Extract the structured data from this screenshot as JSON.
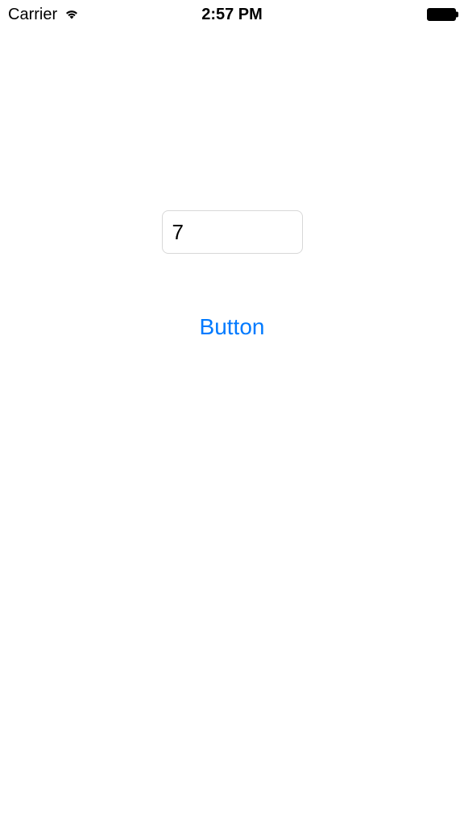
{
  "statusBar": {
    "carrier": "Carrier",
    "time": "2:57 PM"
  },
  "main": {
    "textFieldValue": "7",
    "buttonLabel": "Button"
  }
}
